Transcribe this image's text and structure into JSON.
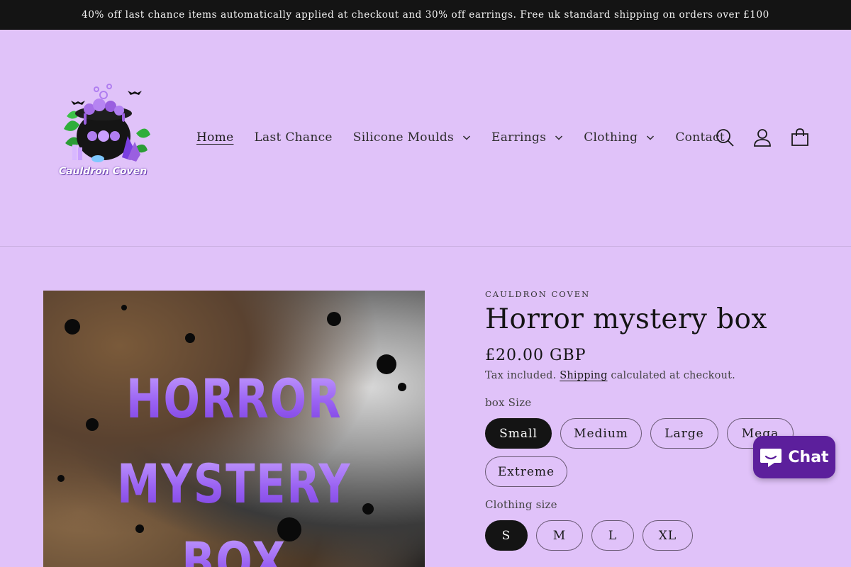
{
  "announcement": "40% off last chance items automatically applied at checkout and 30% off earrings. Free uk standard shipping on orders over £100",
  "logo": {
    "text": "Cauldron Coven"
  },
  "nav": [
    {
      "label": "Home",
      "active": true,
      "dropdown": false
    },
    {
      "label": "Last Chance",
      "active": false,
      "dropdown": false
    },
    {
      "label": "Silicone Moulds",
      "active": false,
      "dropdown": true
    },
    {
      "label": "Earrings",
      "active": false,
      "dropdown": true
    },
    {
      "label": "Clothing",
      "active": false,
      "dropdown": true
    },
    {
      "label": "Contact",
      "active": false,
      "dropdown": false
    }
  ],
  "header_icons": [
    "search-icon",
    "account-icon",
    "cart-icon"
  ],
  "product": {
    "image_text": [
      "HORROR",
      "MYSTERY",
      "BOX"
    ],
    "vendor": "CAULDRON COVEN",
    "title": "Horror mystery box",
    "price": "£20.00 GBP",
    "tax_prefix": "Tax included.",
    "tax_link": "Shipping",
    "tax_suffix": "calculated at checkout."
  },
  "options": {
    "box_size": {
      "label": "box Size",
      "values": [
        "Small",
        "Medium",
        "Large",
        "Mega",
        "Extreme"
      ],
      "selected": "Small"
    },
    "clothing_size": {
      "label": "Clothing size",
      "values": [
        "S",
        "M",
        "L",
        "XL"
      ],
      "selected": "S"
    }
  },
  "chat": {
    "label": "Chat"
  },
  "colors": {
    "page_bg": "#e0c2f9",
    "announcement_bg": "#141414",
    "selected_pill": "#141414",
    "chat_bg": "#5c1f9c",
    "poster_text": "#9a62f2"
  }
}
